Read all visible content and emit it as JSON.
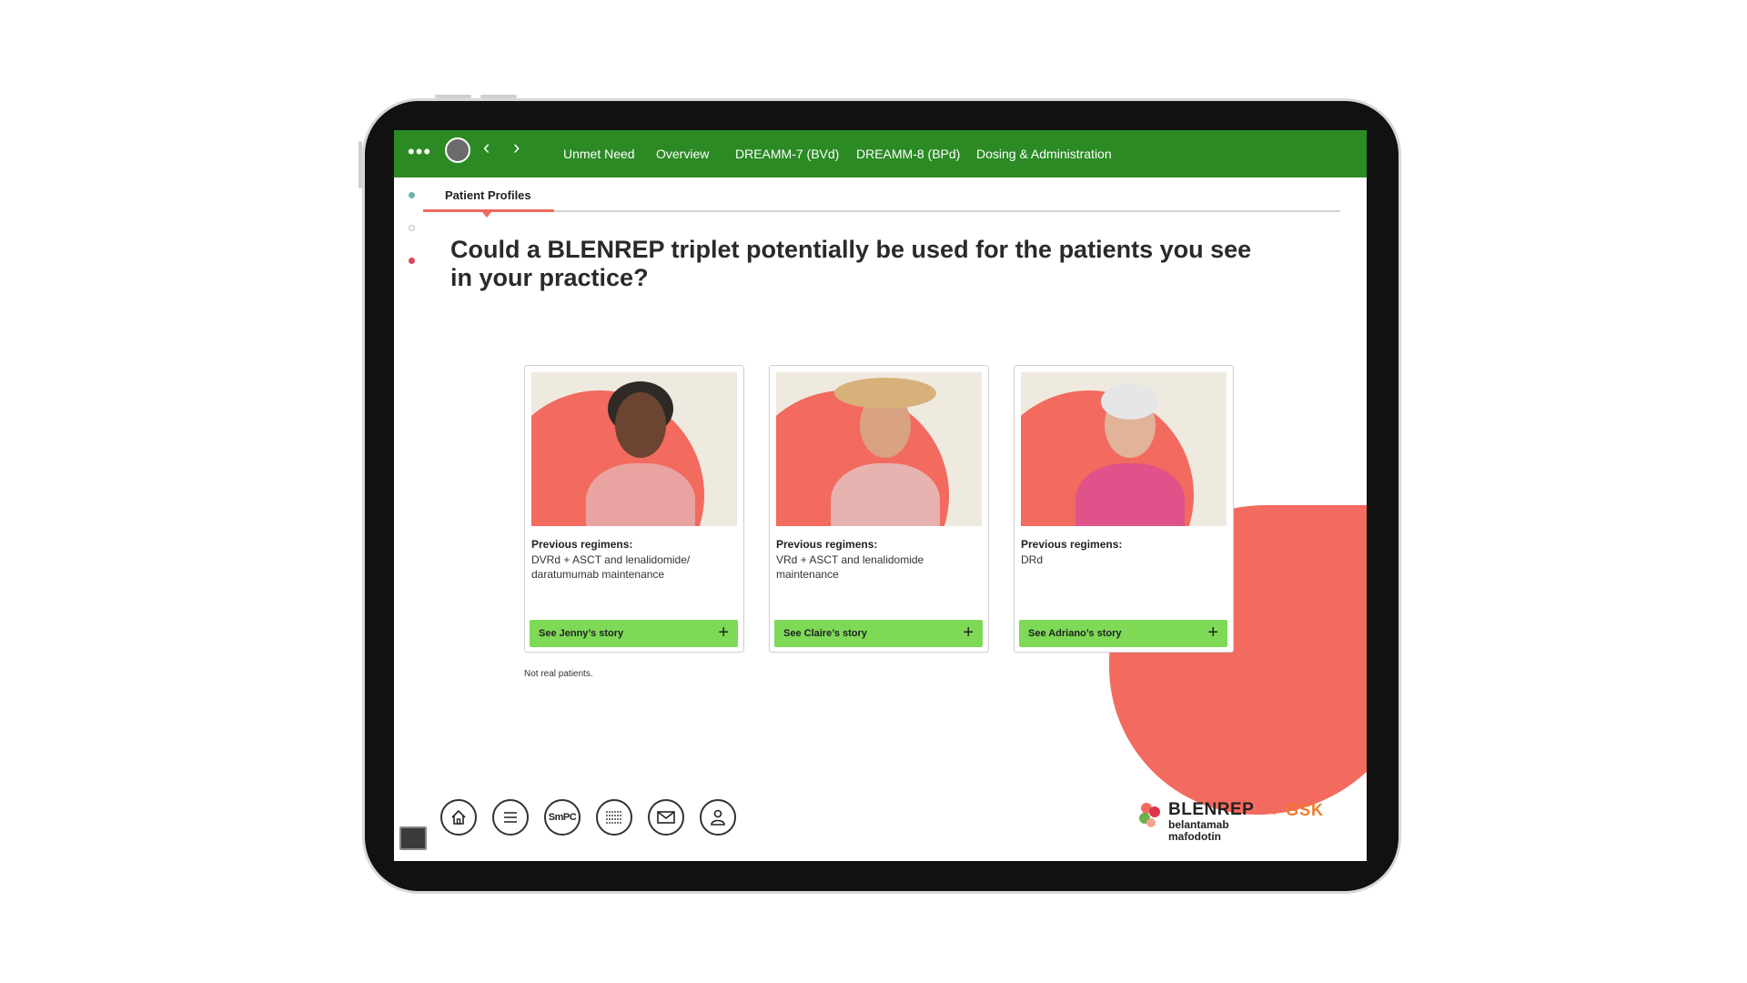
{
  "nav": {
    "items": [
      "Unmet Need",
      "Overview",
      "DREAMM-7 (BVd)",
      "DREAMM-8 (BPd)",
      "Dosing & Administration"
    ]
  },
  "tab": {
    "label": "Patient Profiles"
  },
  "heading": "Could a BLENREP triplet potentially be used for the patients you see in your practice?",
  "cards": [
    {
      "regimen_title": "Previous regimens:",
      "regimen_text": "DVRd + ASCT and lenalidomide/ daratumumab maintenance",
      "button": "See Jenny’s story"
    },
    {
      "regimen_title": "Previous regimens:",
      "regimen_text": "VRd + ASCT and lenalidomide maintenance",
      "button": "See Claire’s story"
    },
    {
      "regimen_title": "Previous regimens:",
      "regimen_text": "DRd",
      "button": "See Adriano’s story"
    }
  ],
  "footnote": "Not real patients.",
  "toolbar": {
    "smpc_label": "SmPC"
  },
  "brand": {
    "name": "BLENREP",
    "generic_name": "belantamab mafodotin",
    "company": "GSK"
  },
  "colors": {
    "nav_green": "#2b8a24",
    "button_green": "#7ed957",
    "coral": "#f36a5e",
    "gsk_orange": "#f07b2a"
  }
}
